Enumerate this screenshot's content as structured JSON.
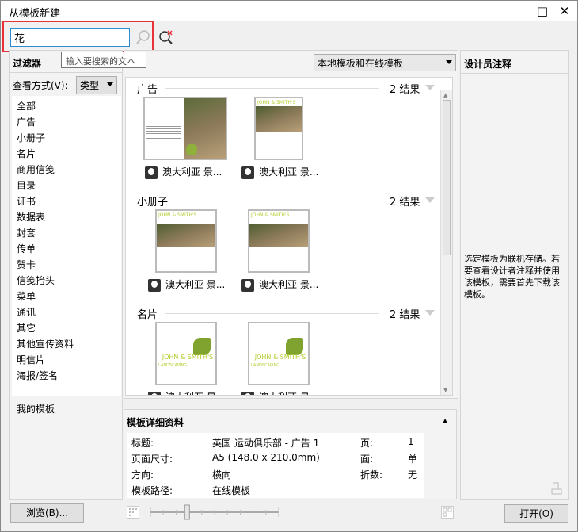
{
  "window": {
    "title": "从模板新建",
    "maximize": "□",
    "close": "✕"
  },
  "search": {
    "value": "花",
    "tooltip": "输入要搜索的文本",
    "search_icon": "search-icon",
    "clear_icon": "clear-search-icon"
  },
  "filter": {
    "title": "过滤器",
    "view_label": "查看方式(V):",
    "view_value": "类型",
    "items": [
      "全部",
      "广告",
      "小册子",
      "名片",
      "商用信笺",
      "目录",
      "证书",
      "数据表",
      "封套",
      "传单",
      "贺卡",
      "信笺抬头",
      "菜单",
      "通讯",
      "其它",
      "其他宣传资料",
      "明信片",
      "海报/签名"
    ],
    "my_templates": "我的模板"
  },
  "source": {
    "value": "本地模板和在线模板"
  },
  "sections": [
    {
      "title": "广告",
      "count": "2 结果",
      "items": [
        {
          "label": "澳大利亚 景..."
        },
        {
          "label": "澳大利亚 景..."
        }
      ]
    },
    {
      "title": "小册子",
      "count": "2 结果",
      "items": [
        {
          "label": "澳大利亚 景..."
        },
        {
          "label": "澳大利亚 景..."
        }
      ]
    },
    {
      "title": "名片",
      "count": "2 结果",
      "items": [
        {
          "label": "澳大利亚 景..."
        },
        {
          "label": "澳大利亚 景..."
        }
      ]
    }
  ],
  "thumb_text": {
    "brand": "JOHN & SMITH'S",
    "sub": "LANDSCAPING"
  },
  "designer": {
    "title": "设计员注释",
    "note": "选定模板为联机存储。若要查看设计者注释并使用该模板，需要首先下载该模板。"
  },
  "details": {
    "title": "模板详细资料",
    "rows": [
      {
        "k1": "标题:",
        "v1": "英国 运动俱乐部 - 广告 1",
        "k2": "页:",
        "v2": "1"
      },
      {
        "k1": "页面尺寸:",
        "v1": "A5 (148.0 x 210.0mm)",
        "k2": "面:",
        "v2": "单"
      },
      {
        "k1": "方向:",
        "v1": "横向",
        "k2": "折数:",
        "v2": "无"
      },
      {
        "k1": "模板路径:",
        "v1": "在线模板",
        "k2": "",
        "v2": ""
      }
    ]
  },
  "buttons": {
    "browse": "浏览(B)...",
    "open": "打开(O)"
  },
  "zoom_slider": {
    "position_step": 3,
    "steps": 10
  },
  "colors": {
    "accent": "#2a8dd4",
    "highlight": "#e8323a",
    "brand_green": "#b5cc2e"
  }
}
